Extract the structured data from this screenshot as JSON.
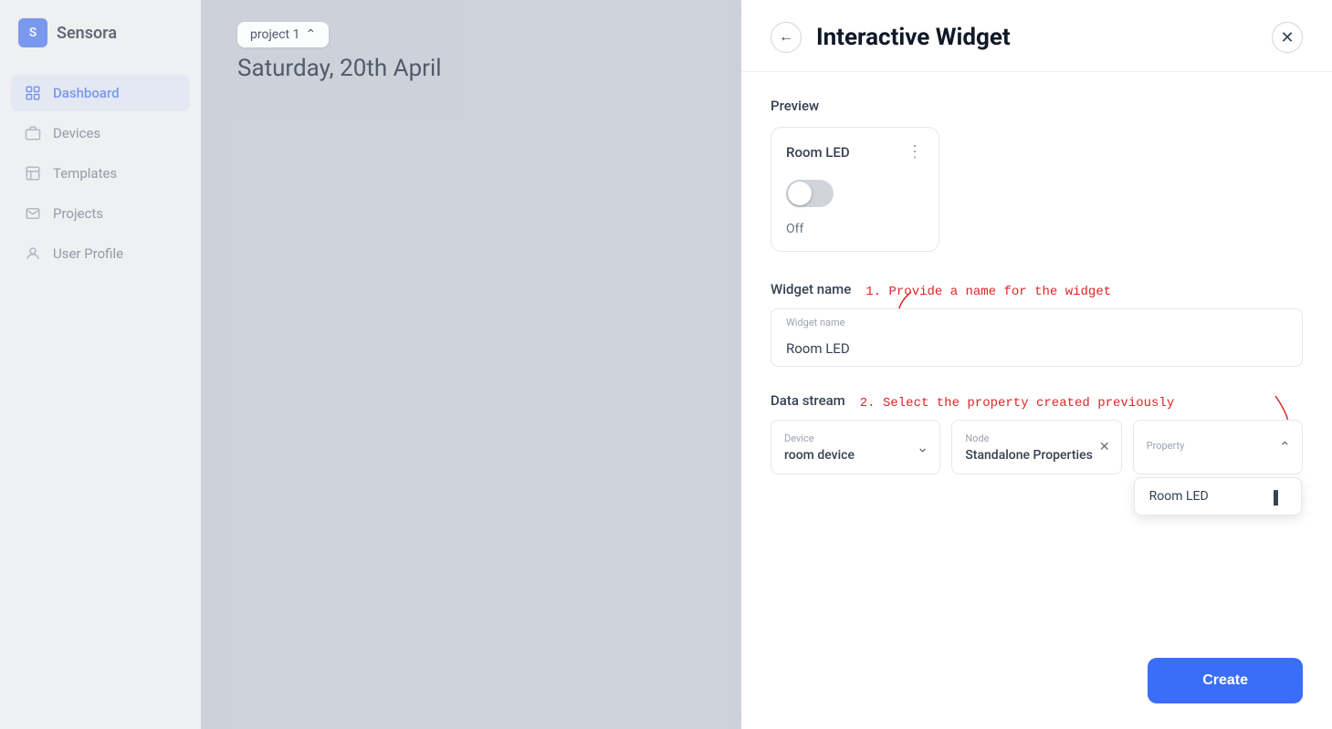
{
  "app": {
    "logo_letter": "S",
    "logo_name": "Sensora",
    "project_label": "project 1",
    "date": "Saturday, 20th April"
  },
  "sidebar": {
    "items": [
      {
        "id": "dashboard",
        "label": "Dashboard",
        "icon": "dashboard",
        "active": true
      },
      {
        "id": "devices",
        "label": "Devices",
        "icon": "devices",
        "active": false
      },
      {
        "id": "templates",
        "label": "Templates",
        "icon": "templates",
        "active": false
      },
      {
        "id": "projects",
        "label": "Projects",
        "icon": "projects",
        "active": false
      },
      {
        "id": "user-profile",
        "label": "User Profile",
        "icon": "user",
        "active": false
      }
    ]
  },
  "modal": {
    "title": "Interactive Widget",
    "back_label": "←",
    "close_label": "✕",
    "preview_label": "Preview",
    "widget_name_label": "Widget name",
    "widget_name_placeholder": "Widget name",
    "widget_name_value": "Room LED",
    "widget_toggle_status": "Off",
    "widget_card_title": "Room LED",
    "widget_menu_dots": "⋮",
    "data_stream_label": "Data stream",
    "device_label": "Device",
    "device_value": "room device",
    "node_label": "Node",
    "node_value": "Standalone Properties",
    "property_label": "Property",
    "property_dropdown_option": "Room LED",
    "annotation_1": "1. Provide a name for the widget",
    "annotation_2": "2. Select the property created previously",
    "create_button_label": "Create"
  }
}
